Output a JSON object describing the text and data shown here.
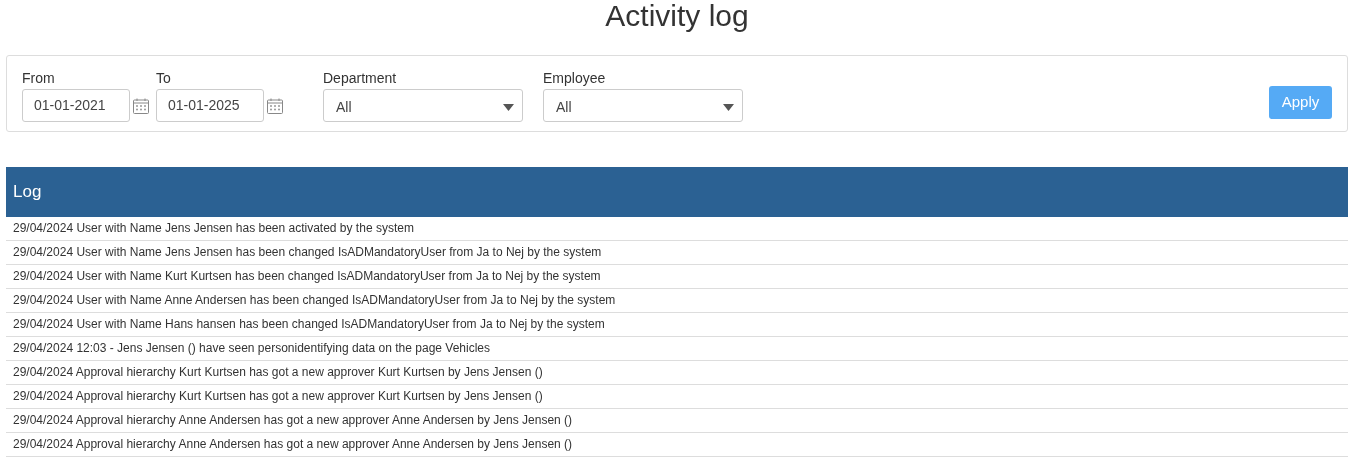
{
  "title": "Activity log",
  "date_filters": [
    {
      "label": "From",
      "value": "01-01-2021"
    },
    {
      "label": "To",
      "value": "01-01-2025"
    }
  ],
  "select_filters": [
    {
      "label": "Department",
      "value": "All"
    },
    {
      "label": "Employee",
      "value": "All"
    }
  ],
  "apply_button": "Apply",
  "log": {
    "header": "Log",
    "rows": [
      "29/04/2024 User with Name Jens Jensen has been activated by the system",
      "29/04/2024 User with Name Jens Jensen has been changed IsADMandatoryUser from Ja to Nej by the system",
      "29/04/2024 User with Name Kurt Kurtsen has been changed IsADMandatoryUser from Ja to Nej by the system",
      "29/04/2024 User with Name Anne Andersen has been changed IsADMandatoryUser from Ja to Nej by the system",
      "29/04/2024 User with Name Hans hansen has been changed IsADMandatoryUser from Ja to Nej by the system",
      "29/04/2024 12:03 - Jens Jensen () have seen personidentifying data on the page Vehicles",
      "29/04/2024 Approval hierarchy Kurt Kurtsen has got a new approver Kurt Kurtsen by Jens Jensen ()",
      "29/04/2024 Approval hierarchy Kurt Kurtsen has got a new approver Kurt Kurtsen by Jens Jensen ()",
      "29/04/2024 Approval hierarchy Anne Andersen has got a new approver Anne Andersen by Jens Jensen ()",
      "29/04/2024 Approval hierarchy Anne Andersen has got a new approver Anne Andersen by Jens Jensen ()"
    ]
  }
}
